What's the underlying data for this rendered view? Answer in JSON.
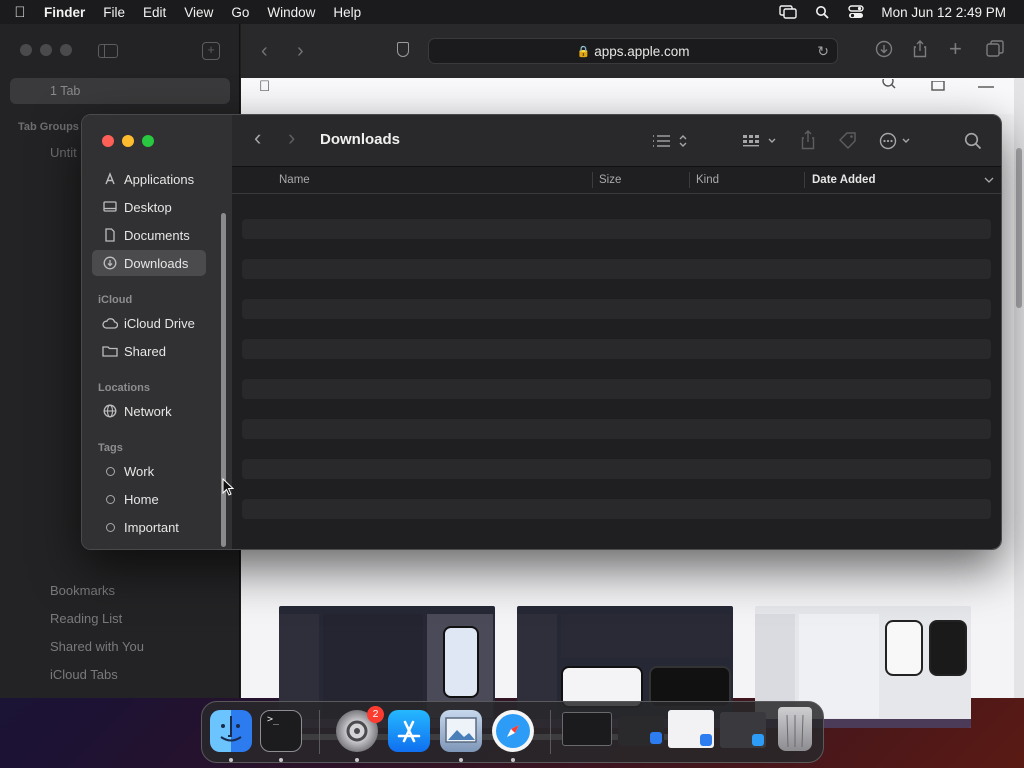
{
  "menubar": {
    "app_name": "Finder",
    "menus": [
      "File",
      "Edit",
      "View",
      "Go",
      "Window",
      "Help"
    ],
    "datetime": "Mon Jun 12  2:49 PM"
  },
  "safari": {
    "tab_count_label": "1 Tab",
    "tab_groups_label": "Tab Groups",
    "untitled_label": "Untit",
    "sidebar_links": [
      "Bookmarks",
      "Reading List",
      "Shared with You",
      "iCloud Tabs"
    ],
    "url": "apps.apple.com"
  },
  "finder": {
    "title": "Downloads",
    "sidebar": {
      "favorites": [
        {
          "label": "Applications",
          "icon": "applications-icon"
        },
        {
          "label": "Desktop",
          "icon": "desktop-icon"
        },
        {
          "label": "Documents",
          "icon": "documents-icon"
        },
        {
          "label": "Downloads",
          "icon": "downloads-icon",
          "selected": true
        }
      ],
      "icloud_header": "iCloud",
      "icloud": [
        {
          "label": "iCloud Drive",
          "icon": "cloud-icon"
        },
        {
          "label": "Shared",
          "icon": "shared-folder-icon"
        }
      ],
      "locations_header": "Locations",
      "locations": [
        {
          "label": "Network",
          "icon": "network-globe-icon"
        }
      ],
      "tags_header": "Tags",
      "tags": [
        "Work",
        "Home",
        "Important"
      ]
    },
    "columns": {
      "name": "Name",
      "size": "Size",
      "kind": "Kind",
      "date_added": "Date Added"
    }
  },
  "dock": {
    "apps": [
      "Finder",
      "Terminal",
      "System Settings",
      "App Store",
      "Preview",
      "Safari"
    ],
    "settings_badge": "2"
  },
  "colors": {
    "traffic_red": "#fe5f57",
    "traffic_yellow": "#febc2e",
    "traffic_green": "#28c840",
    "badge_red": "#fe3b30"
  }
}
